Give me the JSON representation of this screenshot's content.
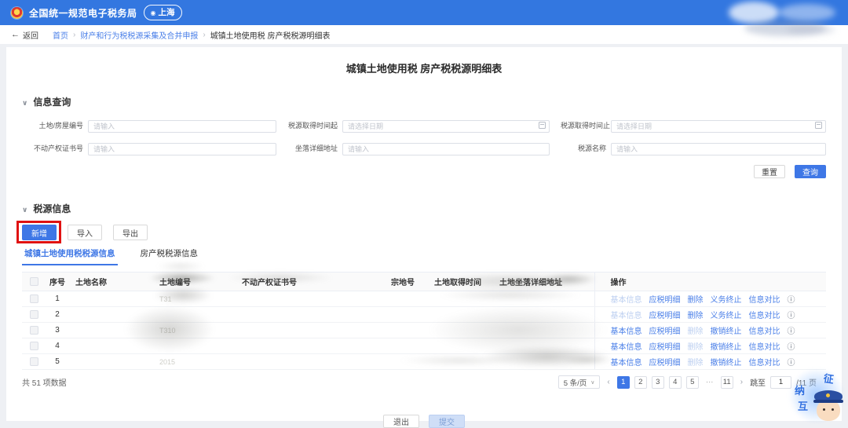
{
  "colors": {
    "accent": "#3377e0",
    "link": "#4a7fe8",
    "highlight": "#e01212"
  },
  "header": {
    "app_title": "全国统一规范电子税务局",
    "location": "上海"
  },
  "breadcrumb": {
    "back": "返回",
    "items": [
      "首页",
      "财产和行为税税源采集及合并申报",
      "城镇土地使用税 房产税税源明细表"
    ]
  },
  "page": {
    "title": "城镇土地使用税 房产税税源明细表"
  },
  "query": {
    "title": "信息查询",
    "fields": [
      {
        "label": "土地/房屋编号",
        "placeholder": "请输入"
      },
      {
        "label": "税源取得时间起",
        "placeholder": "请选择日期"
      },
      {
        "label": "税源取得时间止",
        "placeholder": "请选择日期"
      },
      {
        "label": "不动产权证书号",
        "placeholder": "请输入"
      },
      {
        "label": "坐落详细地址",
        "placeholder": "请输入"
      },
      {
        "label": "税源名称",
        "placeholder": "请输入"
      }
    ],
    "reset": "重置",
    "search": "查询"
  },
  "source": {
    "title": "税源信息",
    "add": "新增",
    "import": "导入",
    "export": "导出",
    "tabs": [
      {
        "label": "城镇土地使用税税源信息",
        "active": true
      },
      {
        "label": "房产税税源信息",
        "active": false
      }
    ]
  },
  "table": {
    "columns": [
      "序号",
      "土地名称",
      "土地编号",
      "不动产权证书号",
      "宗地号",
      "土地取得时间",
      "土地坐落详细地址",
      "操作"
    ],
    "rows": [
      {
        "index": "1",
        "code_fragment": "T31",
        "actions": [
          {
            "label": "基本信息",
            "disabled": true
          },
          {
            "label": "应税明细"
          },
          {
            "label": "删除"
          },
          {
            "label": "义务终止"
          },
          {
            "label": "信息对比"
          }
        ]
      },
      {
        "index": "2",
        "code_fragment": "",
        "actions": [
          {
            "label": "基本信息",
            "disabled": true
          },
          {
            "label": "应税明细"
          },
          {
            "label": "删除"
          },
          {
            "label": "义务终止"
          },
          {
            "label": "信息对比"
          }
        ]
      },
      {
        "index": "3",
        "code_fragment": "T310",
        "actions": [
          {
            "label": "基本信息"
          },
          {
            "label": "应税明细"
          },
          {
            "label": "删除",
            "disabled": true
          },
          {
            "label": "撤销终止"
          },
          {
            "label": "信息对比"
          }
        ]
      },
      {
        "index": "4",
        "code_fragment": "",
        "actions": [
          {
            "label": "基本信息"
          },
          {
            "label": "应税明细"
          },
          {
            "label": "删除",
            "disabled": true
          },
          {
            "label": "撤销终止"
          },
          {
            "label": "信息对比"
          }
        ]
      },
      {
        "index": "5",
        "code_fragment": "2015",
        "actions": [
          {
            "label": "基本信息"
          },
          {
            "label": "应税明细"
          },
          {
            "label": "删除",
            "disabled": true
          },
          {
            "label": "撤销终止"
          },
          {
            "label": "信息对比"
          }
        ]
      }
    ]
  },
  "footer": {
    "total": "共 51 项数据",
    "page_size": "5 条/页",
    "pages": [
      "1",
      "2",
      "3",
      "4",
      "5",
      "···",
      "11"
    ],
    "current_page": "1",
    "jump_label": "跳至",
    "jump_value": "1",
    "total_pages": "/11 页"
  },
  "bottom": {
    "exit": "退出",
    "submit": "提交"
  },
  "mascot": {
    "chars": [
      "征",
      "纳",
      "互"
    ]
  }
}
